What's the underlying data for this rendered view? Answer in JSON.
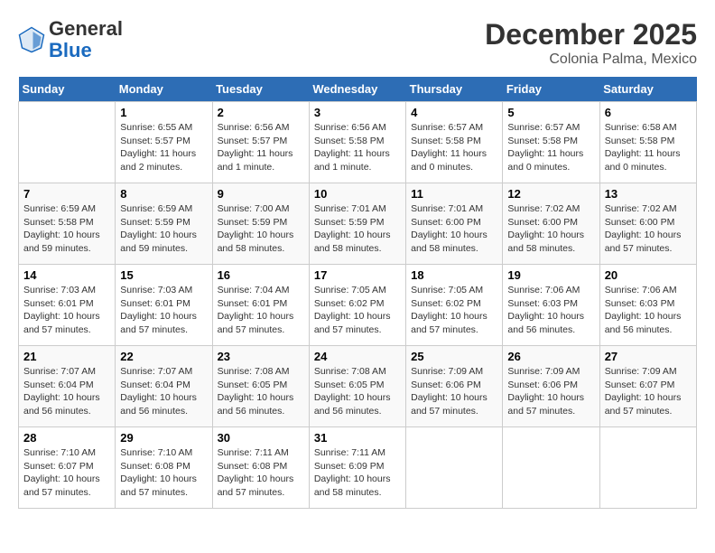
{
  "header": {
    "logo_general": "General",
    "logo_blue": "Blue",
    "month": "December 2025",
    "location": "Colonia Palma, Mexico"
  },
  "weekdays": [
    "Sunday",
    "Monday",
    "Tuesday",
    "Wednesday",
    "Thursday",
    "Friday",
    "Saturday"
  ],
  "weeks": [
    [
      {
        "day": "",
        "text": ""
      },
      {
        "day": "1",
        "text": "Sunrise: 6:55 AM\nSunset: 5:57 PM\nDaylight: 11 hours\nand 2 minutes."
      },
      {
        "day": "2",
        "text": "Sunrise: 6:56 AM\nSunset: 5:57 PM\nDaylight: 11 hours\nand 1 minute."
      },
      {
        "day": "3",
        "text": "Sunrise: 6:56 AM\nSunset: 5:58 PM\nDaylight: 11 hours\nand 1 minute."
      },
      {
        "day": "4",
        "text": "Sunrise: 6:57 AM\nSunset: 5:58 PM\nDaylight: 11 hours\nand 0 minutes."
      },
      {
        "day": "5",
        "text": "Sunrise: 6:57 AM\nSunset: 5:58 PM\nDaylight: 11 hours\nand 0 minutes."
      },
      {
        "day": "6",
        "text": "Sunrise: 6:58 AM\nSunset: 5:58 PM\nDaylight: 11 hours\nand 0 minutes."
      }
    ],
    [
      {
        "day": "7",
        "text": "Sunrise: 6:59 AM\nSunset: 5:58 PM\nDaylight: 10 hours\nand 59 minutes."
      },
      {
        "day": "8",
        "text": "Sunrise: 6:59 AM\nSunset: 5:59 PM\nDaylight: 10 hours\nand 59 minutes."
      },
      {
        "day": "9",
        "text": "Sunrise: 7:00 AM\nSunset: 5:59 PM\nDaylight: 10 hours\nand 58 minutes."
      },
      {
        "day": "10",
        "text": "Sunrise: 7:01 AM\nSunset: 5:59 PM\nDaylight: 10 hours\nand 58 minutes."
      },
      {
        "day": "11",
        "text": "Sunrise: 7:01 AM\nSunset: 6:00 PM\nDaylight: 10 hours\nand 58 minutes."
      },
      {
        "day": "12",
        "text": "Sunrise: 7:02 AM\nSunset: 6:00 PM\nDaylight: 10 hours\nand 58 minutes."
      },
      {
        "day": "13",
        "text": "Sunrise: 7:02 AM\nSunset: 6:00 PM\nDaylight: 10 hours\nand 57 minutes."
      }
    ],
    [
      {
        "day": "14",
        "text": "Sunrise: 7:03 AM\nSunset: 6:01 PM\nDaylight: 10 hours\nand 57 minutes."
      },
      {
        "day": "15",
        "text": "Sunrise: 7:03 AM\nSunset: 6:01 PM\nDaylight: 10 hours\nand 57 minutes."
      },
      {
        "day": "16",
        "text": "Sunrise: 7:04 AM\nSunset: 6:01 PM\nDaylight: 10 hours\nand 57 minutes."
      },
      {
        "day": "17",
        "text": "Sunrise: 7:05 AM\nSunset: 6:02 PM\nDaylight: 10 hours\nand 57 minutes."
      },
      {
        "day": "18",
        "text": "Sunrise: 7:05 AM\nSunset: 6:02 PM\nDaylight: 10 hours\nand 57 minutes."
      },
      {
        "day": "19",
        "text": "Sunrise: 7:06 AM\nSunset: 6:03 PM\nDaylight: 10 hours\nand 56 minutes."
      },
      {
        "day": "20",
        "text": "Sunrise: 7:06 AM\nSunset: 6:03 PM\nDaylight: 10 hours\nand 56 minutes."
      }
    ],
    [
      {
        "day": "21",
        "text": "Sunrise: 7:07 AM\nSunset: 6:04 PM\nDaylight: 10 hours\nand 56 minutes."
      },
      {
        "day": "22",
        "text": "Sunrise: 7:07 AM\nSunset: 6:04 PM\nDaylight: 10 hours\nand 56 minutes."
      },
      {
        "day": "23",
        "text": "Sunrise: 7:08 AM\nSunset: 6:05 PM\nDaylight: 10 hours\nand 56 minutes."
      },
      {
        "day": "24",
        "text": "Sunrise: 7:08 AM\nSunset: 6:05 PM\nDaylight: 10 hours\nand 56 minutes."
      },
      {
        "day": "25",
        "text": "Sunrise: 7:09 AM\nSunset: 6:06 PM\nDaylight: 10 hours\nand 57 minutes."
      },
      {
        "day": "26",
        "text": "Sunrise: 7:09 AM\nSunset: 6:06 PM\nDaylight: 10 hours\nand 57 minutes."
      },
      {
        "day": "27",
        "text": "Sunrise: 7:09 AM\nSunset: 6:07 PM\nDaylight: 10 hours\nand 57 minutes."
      }
    ],
    [
      {
        "day": "28",
        "text": "Sunrise: 7:10 AM\nSunset: 6:07 PM\nDaylight: 10 hours\nand 57 minutes."
      },
      {
        "day": "29",
        "text": "Sunrise: 7:10 AM\nSunset: 6:08 PM\nDaylight: 10 hours\nand 57 minutes."
      },
      {
        "day": "30",
        "text": "Sunrise: 7:11 AM\nSunset: 6:08 PM\nDaylight: 10 hours\nand 57 minutes."
      },
      {
        "day": "31",
        "text": "Sunrise: 7:11 AM\nSunset: 6:09 PM\nDaylight: 10 hours\nand 58 minutes."
      },
      {
        "day": "",
        "text": ""
      },
      {
        "day": "",
        "text": ""
      },
      {
        "day": "",
        "text": ""
      }
    ]
  ]
}
